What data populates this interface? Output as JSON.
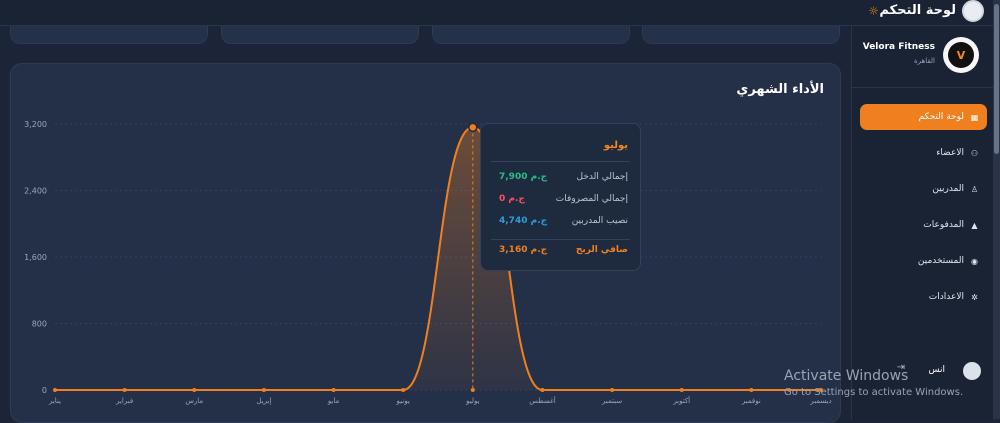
{
  "header": {
    "title": "لوحة التحكم"
  },
  "sidebar": {
    "brand_name": "Velora Fitness",
    "brand_city": "القاهرة",
    "logo_letter": "V",
    "items": [
      {
        "label": "لوحة التحكم",
        "icon": "grid-icon",
        "active": true
      },
      {
        "label": "الاعضاء",
        "icon": "users-icon",
        "active": false
      },
      {
        "label": "المدربين",
        "icon": "person-icon",
        "active": false
      },
      {
        "label": "المدفوعات",
        "icon": "money-icon",
        "active": false
      },
      {
        "label": "المستخدمين",
        "icon": "user-shield-icon",
        "active": false
      },
      {
        "label": "الاعدادات",
        "icon": "gear-icon",
        "active": false
      }
    ],
    "user": {
      "name": "انس"
    }
  },
  "card": {
    "title": "الأداء الشهري"
  },
  "chart_data": {
    "type": "area",
    "categories": [
      "يناير",
      "فبراير",
      "مارس",
      "إبريل",
      "مايو",
      "يونيو",
      "يوليو",
      "أغسطس",
      "سبتمبر",
      "أكتوبر",
      "نوفمبر",
      "ديسمبر"
    ],
    "values": [
      0,
      0,
      0,
      0,
      0,
      0,
      3160,
      0,
      0,
      0,
      0,
      0
    ],
    "yticks": [
      "3,200",
      "2,400",
      "1,600",
      "800",
      "0"
    ],
    "ylim": [
      0,
      3200
    ],
    "grid": true,
    "color": "#f0801f"
  },
  "tooltip": {
    "month": "يوليو",
    "rows": [
      {
        "label": "إجمالي الدخل",
        "value": "7,900 ج.م",
        "color": "#27c08a"
      },
      {
        "label": "إجمالي المصروفات",
        "value": "0 ج.م",
        "color": "#ff4d6a"
      },
      {
        "label": "نصيب المدربين",
        "value": "4,740 ج.م",
        "color": "#2d9cdb"
      }
    ],
    "net_label": "صافي الربح",
    "net_value": "3,160 ج.م",
    "net_color": "#f0801f"
  },
  "watermark": {
    "line1": "Activate Windows",
    "line2": "Go to Settings to activate Windows."
  }
}
